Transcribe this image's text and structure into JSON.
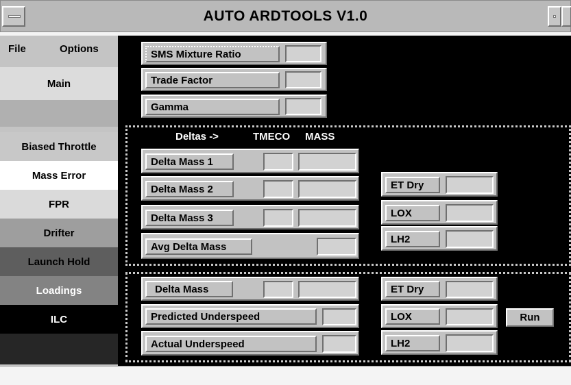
{
  "window": {
    "title": "AUTO ARDTOOLS V1.0"
  },
  "menu": {
    "file": "File",
    "options": "Options"
  },
  "sidebar": {
    "items": [
      {
        "label": "Main"
      },
      {
        "label": ""
      },
      {
        "label": "Biased Throttle"
      },
      {
        "label": "Mass Error"
      },
      {
        "label": "FPR"
      },
      {
        "label": "Drifter"
      },
      {
        "label": "Launch Hold"
      },
      {
        "label": "Loadings"
      },
      {
        "label": "ILC"
      },
      {
        "label": ""
      }
    ]
  },
  "top_fields": [
    {
      "label": "SMS Mixture Ratio",
      "value": ""
    },
    {
      "label": "Trade Factor",
      "value": ""
    },
    {
      "label": "Gamma",
      "value": ""
    }
  ],
  "deltas": {
    "header_prefix": "Deltas ->",
    "col_tmeco": "TMECO",
    "col_mass": "MASS",
    "rows": [
      {
        "label": "Delta Mass 1",
        "tmeco": "",
        "mass": ""
      },
      {
        "label": "Delta Mass 2",
        "tmeco": "",
        "mass": ""
      },
      {
        "label": "Delta Mass 3",
        "tmeco": "",
        "mass": ""
      },
      {
        "label": "Avg Delta Mass",
        "mass": ""
      }
    ],
    "right": [
      {
        "label": "ET Dry",
        "value": ""
      },
      {
        "label": "LOX",
        "value": ""
      },
      {
        "label": "LH2",
        "value": ""
      }
    ]
  },
  "bottom": {
    "rows": [
      {
        "label": "Delta Mass",
        "tmeco": "",
        "mass": ""
      },
      {
        "label": "Predicted Underspeed",
        "value": ""
      },
      {
        "label": "Actual Underspeed",
        "value": ""
      }
    ],
    "right": [
      {
        "label": "ET Dry",
        "value": ""
      },
      {
        "label": "LOX",
        "value": ""
      },
      {
        "label": "LH2",
        "value": ""
      }
    ],
    "run_label": "Run"
  },
  "colors": {
    "panel_bg": "#000000",
    "widget_grey": "#c2c2c2",
    "title_bar": "#b9b9b9"
  }
}
